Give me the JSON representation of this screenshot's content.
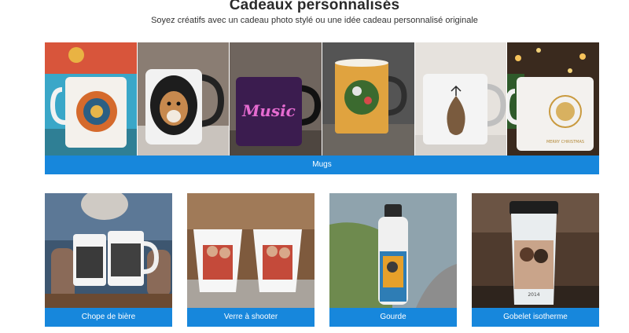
{
  "header": {
    "title": "Cadeaux personnalisés",
    "subtitle": "Soyez créatifs avec un cadeau photo stylé ou une idée cadeau personnalisé originale"
  },
  "mugs_banner": {
    "label": "Mugs",
    "images": [
      {
        "name": "mug-floral-photo",
        "mug_text": ""
      },
      {
        "name": "mug-dog-photo",
        "mug_text": ""
      },
      {
        "name": "mug-music-photo",
        "mug_text": "Music"
      },
      {
        "name": "mug-enamel-floral-photo",
        "mug_text": ""
      },
      {
        "name": "mug-pinecone-photo",
        "mug_text": ""
      },
      {
        "name": "mug-christmas-ornament-photo",
        "mug_text": "MERRY CHRISTMAS"
      }
    ]
  },
  "categories": [
    {
      "label": "Chope de bière"
    },
    {
      "label": "Verre à shooter"
    },
    {
      "label": "Gourde"
    },
    {
      "label": "Gobelet isotherme",
      "print_text": "2014"
    }
  ],
  "colors": {
    "accent": "#1787dc",
    "title": "#2a2a2a"
  }
}
